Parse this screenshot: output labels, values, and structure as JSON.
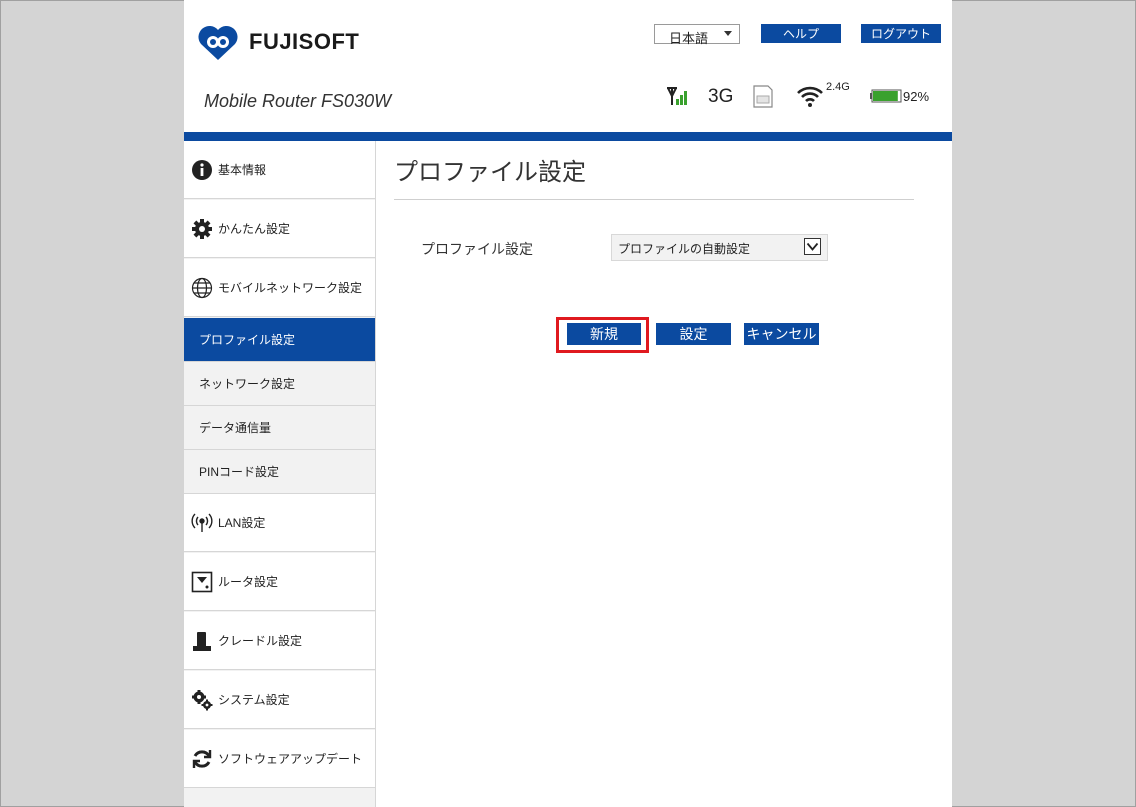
{
  "header": {
    "brand": "FUJISOFT",
    "model": "Mobile Router FS030W",
    "language": "日本語",
    "help_label": "ヘルプ",
    "logout_label": "ログアウト"
  },
  "status": {
    "network_type": "3G",
    "wifi_band": "2.4G",
    "battery_percent": "92%",
    "battery_level": 0.92
  },
  "sidebar": {
    "items": [
      {
        "label": "基本情報",
        "icon": "info-icon"
      },
      {
        "label": "かんたん設定",
        "icon": "gear-icon"
      },
      {
        "label": "モバイルネットワーク設定",
        "icon": "globe-icon"
      },
      {
        "label": "プロファイル設定",
        "sub": true,
        "active": true
      },
      {
        "label": "ネットワーク設定",
        "sub": true
      },
      {
        "label": "データ通信量",
        "sub": true
      },
      {
        "label": "PINコード設定",
        "sub": true
      },
      {
        "label": "LAN設定",
        "icon": "antenna-icon"
      },
      {
        "label": "ルータ設定",
        "icon": "router-icon"
      },
      {
        "label": "クレードル設定",
        "icon": "cradle-icon"
      },
      {
        "label": "システム設定",
        "icon": "gears-icon"
      },
      {
        "label": "ソフトウェアアップデート",
        "icon": "refresh-icon"
      }
    ]
  },
  "main": {
    "title": "プロファイル設定",
    "field_label": "プロファイル設定",
    "profile_value": "プロファイルの自動設定",
    "new_label": "新規",
    "set_label": "設定",
    "cancel_label": "キャンセル"
  },
  "colors": {
    "brand_blue": "#0b4aa0",
    "highlight_red": "#e0191f",
    "signal_green": "#3aa12e"
  }
}
